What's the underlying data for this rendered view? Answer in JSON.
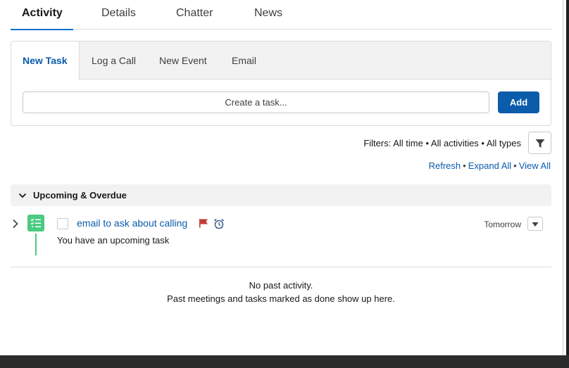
{
  "main_tabs": [
    {
      "label": "Activity",
      "active": true
    },
    {
      "label": "Details"
    },
    {
      "label": "Chatter"
    },
    {
      "label": "News"
    }
  ],
  "publisher": {
    "tabs": [
      {
        "label": "New Task",
        "active": true
      },
      {
        "label": "Log a Call"
      },
      {
        "label": "New Event"
      },
      {
        "label": "Email"
      }
    ],
    "task_placeholder": "Create a task...",
    "add_label": "Add"
  },
  "filters": {
    "text": "Filters: All time • All activities • All types",
    "icon": "filter-icon"
  },
  "links": {
    "refresh": "Refresh",
    "expand_all": "Expand All",
    "view_all": "View All",
    "separator": "•"
  },
  "section": {
    "title": "Upcoming & Overdue"
  },
  "task": {
    "title": "email to ask about calling",
    "subtitle": "You have an upcoming task",
    "date": "Tomorrow",
    "flag_color": "#c23934",
    "icon_color": "#4bca81"
  },
  "empty_state": {
    "title": "No past activity.",
    "subtitle": "Past meetings and tasks marked as done show up here."
  },
  "colors": {
    "accent": "#0b5cab",
    "tab_underline": "#0070d2"
  }
}
